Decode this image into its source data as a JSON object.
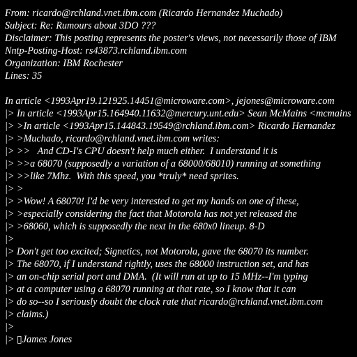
{
  "colors": {
    "background": "#000000",
    "text": "#ffffff"
  },
  "lines": [
    "From: ricardo@rchland.vnet.ibm.com (Ricardo Hernandez Muchado)",
    "Subject: Re: Rumours about 3DO ???",
    "Disclaimer: This posting represents the poster's views, not necessarily those of IBM",
    "Nntp-Posting-Host: rs43873.rchland.ibm.com",
    "Organization: IBM Rochester",
    "Lines: 35",
    "",
    "In article <1993Apr19.121925.14451@microware.com>, jejones@microware.com",
    "|> In article <1993Apr15.164940.11632@mercury.unt.edu> Sean McMains <mcmains",
    "|> >In article <1993Apr15.144843.19549@rchland.ibm.com> Ricardo Hernandez",
    "|> >Muchado, ricardo@rchland.vnet.ibm.com writes:",
    "|> >>   And CD-I's CPU doesn't help much either.  I understand it is",
    "|> >>a 68070 (supposedly a variation of a 68000/68010) running at something",
    "|> >>like 7Mhz.  With this speed, you *truly* need sprites.",
    "|> >",
    "|> >Wow! A 68070! I'd be very interested to get my hands on one of these,",
    "|> >especially considering the fact that Motorola has not yet released the",
    "|> >68060, which is supposedly the next in the 680x0 lineup. 8-D",
    "|>",
    "|> Don't get too excited; Signetics, not Motorola, gave the 68070 its number.",
    "|> The 68070, if I understand rightly, uses the 68000 instruction set, and has",
    "|> an on-chip serial port and DMA.  (It will run at up to 15 MHz--I'm typing",
    "|> at a computer using a 68070 running at that rate, so I know that it can",
    "|> do so--so I seriously doubt the clock rate that ricardo@rchland.vnet.ibm.com",
    "|> claims.)",
    "|>",
    "|> ▯James Jones"
  ]
}
